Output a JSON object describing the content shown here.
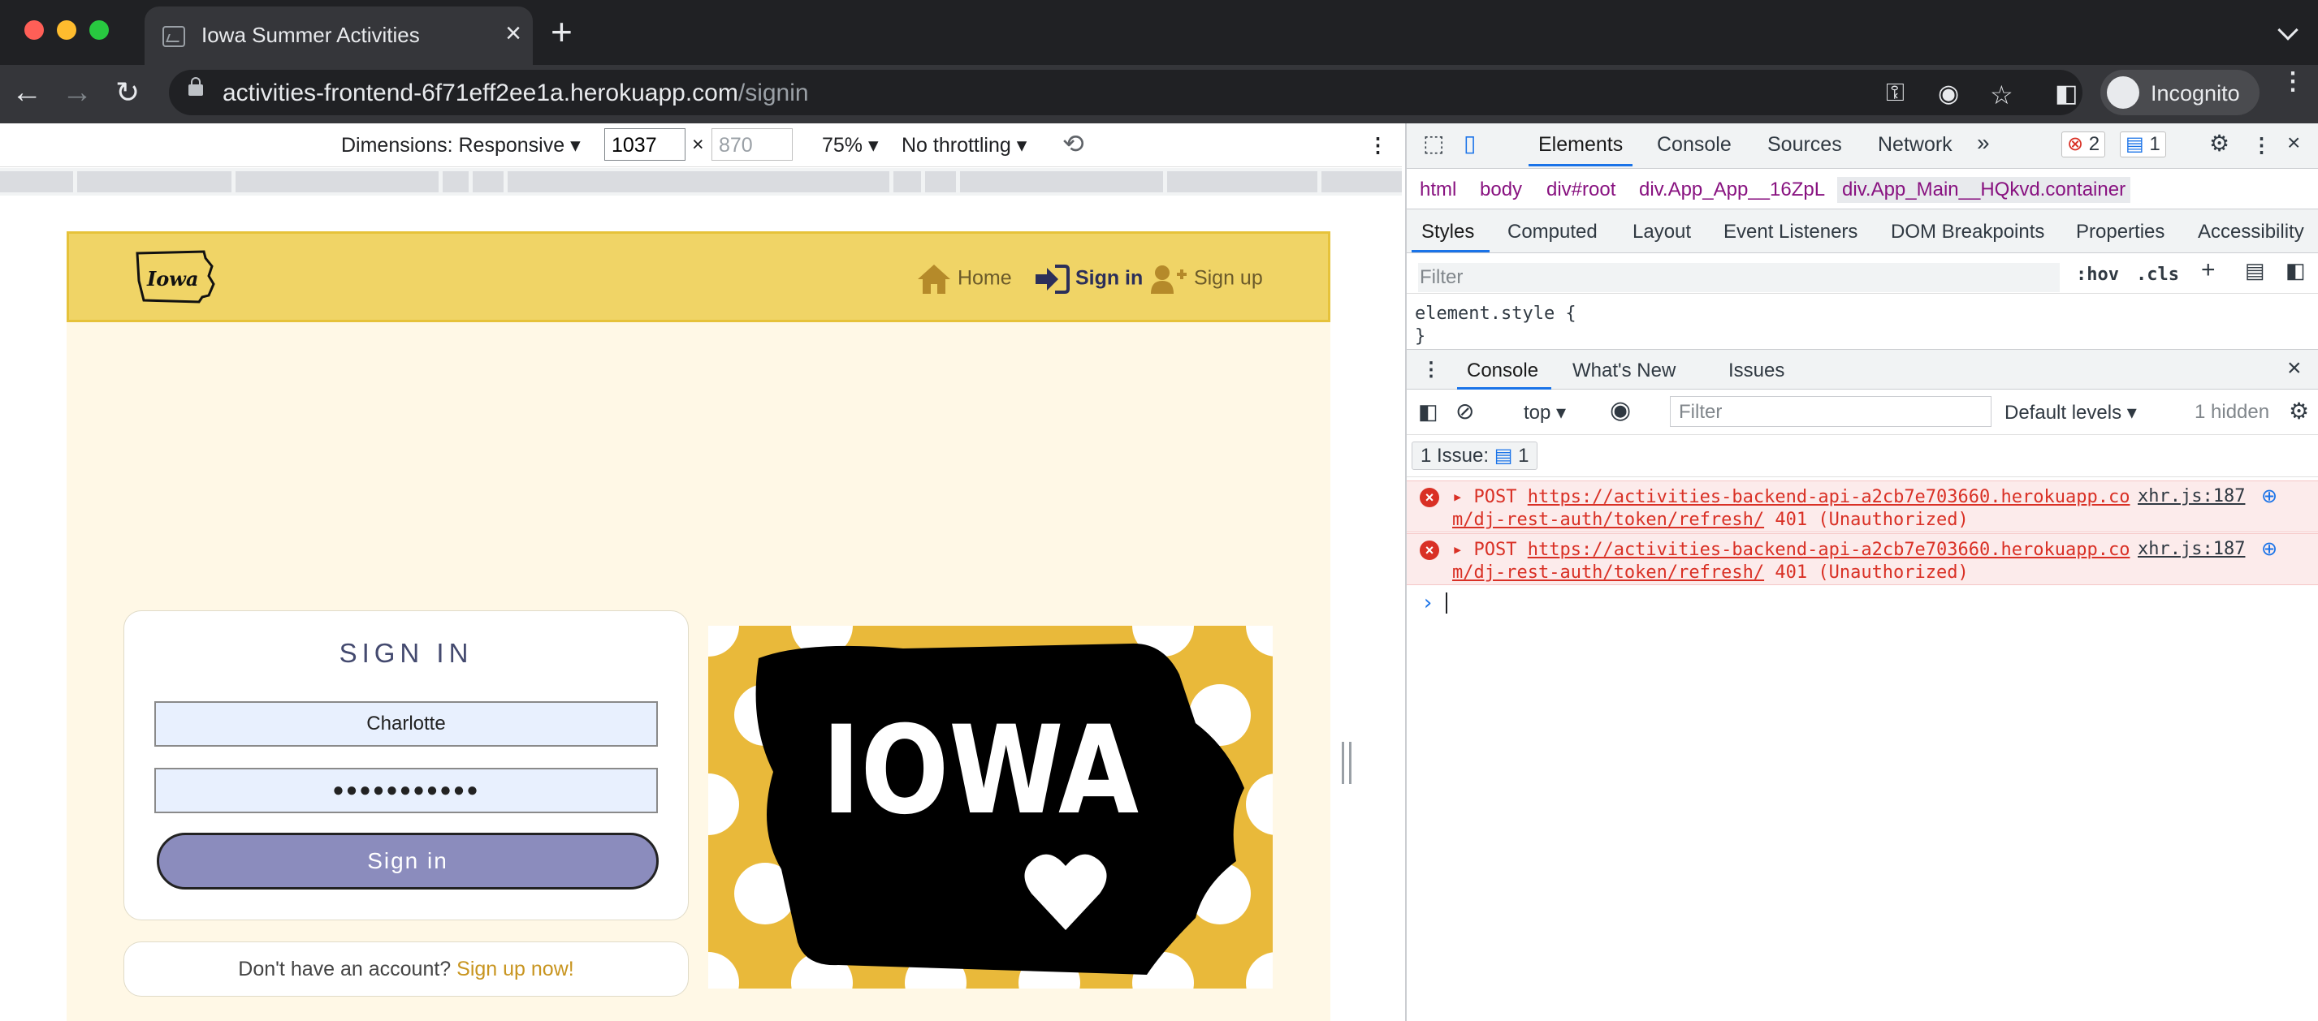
{
  "browser": {
    "tab_title": "Iowa Summer Activities",
    "url_host": "activities-frontend-6f71eff2ee1a.herokuapp.com",
    "url_path": "/signin",
    "profile_label": "Incognito"
  },
  "device_toolbar": {
    "dimensions_label": "Dimensions: Responsive",
    "width": "1037",
    "height_placeholder": "870",
    "times": "×",
    "zoom": "75%",
    "throttling": "No throttling"
  },
  "site": {
    "logo_text": "Iowa",
    "nav": {
      "home": "Home",
      "signin": "Sign in",
      "signup": "Sign up"
    },
    "signin_heading": "SIGN IN",
    "username_value": "Charlotte",
    "password_value": "●●●●●●●●●●●",
    "signin_button": "Sign in",
    "no_account_text": "Don't have an account?",
    "signup_link": "Sign up now!",
    "image_text": "IOWA"
  },
  "devtools": {
    "tabs": [
      "Elements",
      "Console",
      "Sources",
      "Network"
    ],
    "error_count": "2",
    "message_count": "1",
    "breadcrumbs": [
      "html",
      "body",
      "div#root",
      "div.App_App__16ZpL",
      "div.App_Main__HQkvd.container"
    ],
    "subtabs": [
      "Styles",
      "Computed",
      "Layout",
      "Event Listeners",
      "DOM Breakpoints",
      "Properties",
      "Accessibility"
    ],
    "filter_placeholder": "Filter",
    "hov": ":hov",
    "cls": ".cls",
    "element_style_open": "element.style {",
    "element_style_close": "}",
    "drawer_tabs": [
      "Console",
      "What's New",
      "Issues"
    ],
    "context": "top",
    "console_filter_placeholder": "Filter",
    "levels": "Default levels",
    "hidden": "1 hidden",
    "issues_label": "1 Issue:",
    "issues_count": "1",
    "errors": [
      {
        "method": "POST",
        "url_line1": "https://activities-backend-api-a2cb7e703660.herokuapp.co",
        "url_line2": "m/dj-rest-auth/token/refresh/",
        "status": "401 (Unauthorized)",
        "source": "xhr.js:187"
      },
      {
        "method": "POST",
        "url_line1": "https://activities-backend-api-a2cb7e703660.herokuapp.co",
        "url_line2": "m/dj-rest-auth/token/refresh/",
        "status": "401 (Unauthorized)",
        "source": "xhr.js:187"
      }
    ],
    "prompt": "›"
  },
  "colors": {
    "site_header": "#f0d466",
    "site_bg": "#fff8e6",
    "button": "#8b8cbd",
    "link": "#c89520",
    "error": "#d93025"
  }
}
